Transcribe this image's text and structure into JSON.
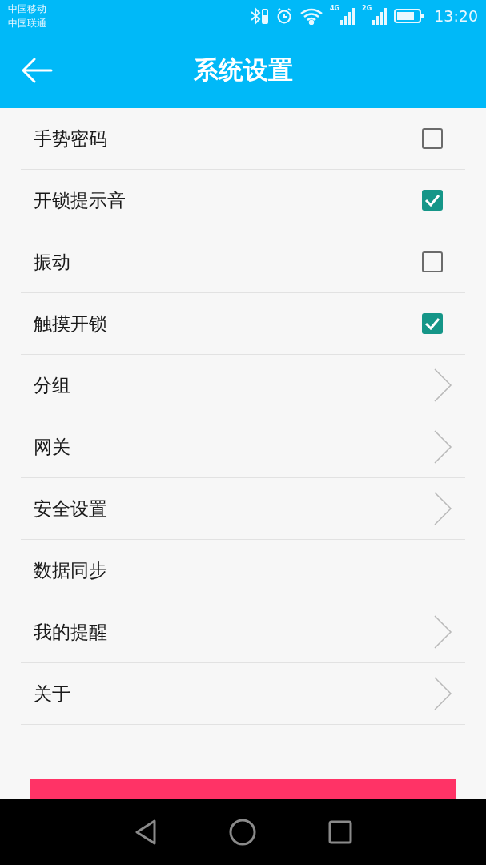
{
  "status_bar": {
    "carriers": [
      "中国移动",
      "中国联通"
    ],
    "network_1": "4G",
    "network_2": "2G",
    "time": "13:20"
  },
  "header": {
    "title": "系统设置"
  },
  "settings": [
    {
      "label": "手势密码",
      "kind": "checkbox",
      "checked": false
    },
    {
      "label": "开锁提示音",
      "kind": "checkbox",
      "checked": true
    },
    {
      "label": "振动",
      "kind": "checkbox",
      "checked": false
    },
    {
      "label": "触摸开锁",
      "kind": "checkbox",
      "checked": true
    },
    {
      "label": "分组",
      "kind": "link"
    },
    {
      "label": "网关",
      "kind": "link"
    },
    {
      "label": "安全设置",
      "kind": "link"
    },
    {
      "label": "数据同步",
      "kind": "plain"
    },
    {
      "label": "我的提醒",
      "kind": "link"
    },
    {
      "label": "关于",
      "kind": "link"
    }
  ]
}
